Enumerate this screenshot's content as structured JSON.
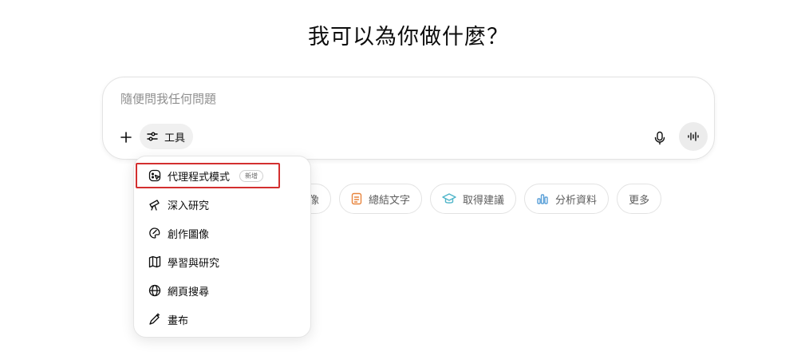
{
  "headline": "我可以為你做什麼？",
  "composer": {
    "placeholder": "隨便問我任何問題",
    "value": "",
    "tools_label": "工具"
  },
  "menu": {
    "items": [
      {
        "label": "代理程式模式",
        "icon": "agent-icon",
        "badge": "新增"
      },
      {
        "label": "深入研究",
        "icon": "telescope-icon"
      },
      {
        "label": "創作圖像",
        "icon": "palette-icon"
      },
      {
        "label": "學習與研究",
        "icon": "book-icon"
      },
      {
        "label": "網頁搜尋",
        "icon": "globe-icon"
      },
      {
        "label": "畫布",
        "icon": "canvas-pen-icon"
      }
    ]
  },
  "chips": [
    {
      "label": "像",
      "icon": "image-icon"
    },
    {
      "label": "總結文字",
      "icon": "document-icon",
      "icon_color": "#e8843c"
    },
    {
      "label": "取得建議",
      "icon": "graduation-cap-icon",
      "icon_color": "#4fb5c9"
    },
    {
      "label": "分析資料",
      "icon": "bar-chart-icon",
      "icon_color": "#5aa0d8"
    },
    {
      "label": "更多"
    }
  ],
  "colors": {
    "highlight_border": "#d32f2f",
    "voice_button_bg": "#ececec"
  }
}
